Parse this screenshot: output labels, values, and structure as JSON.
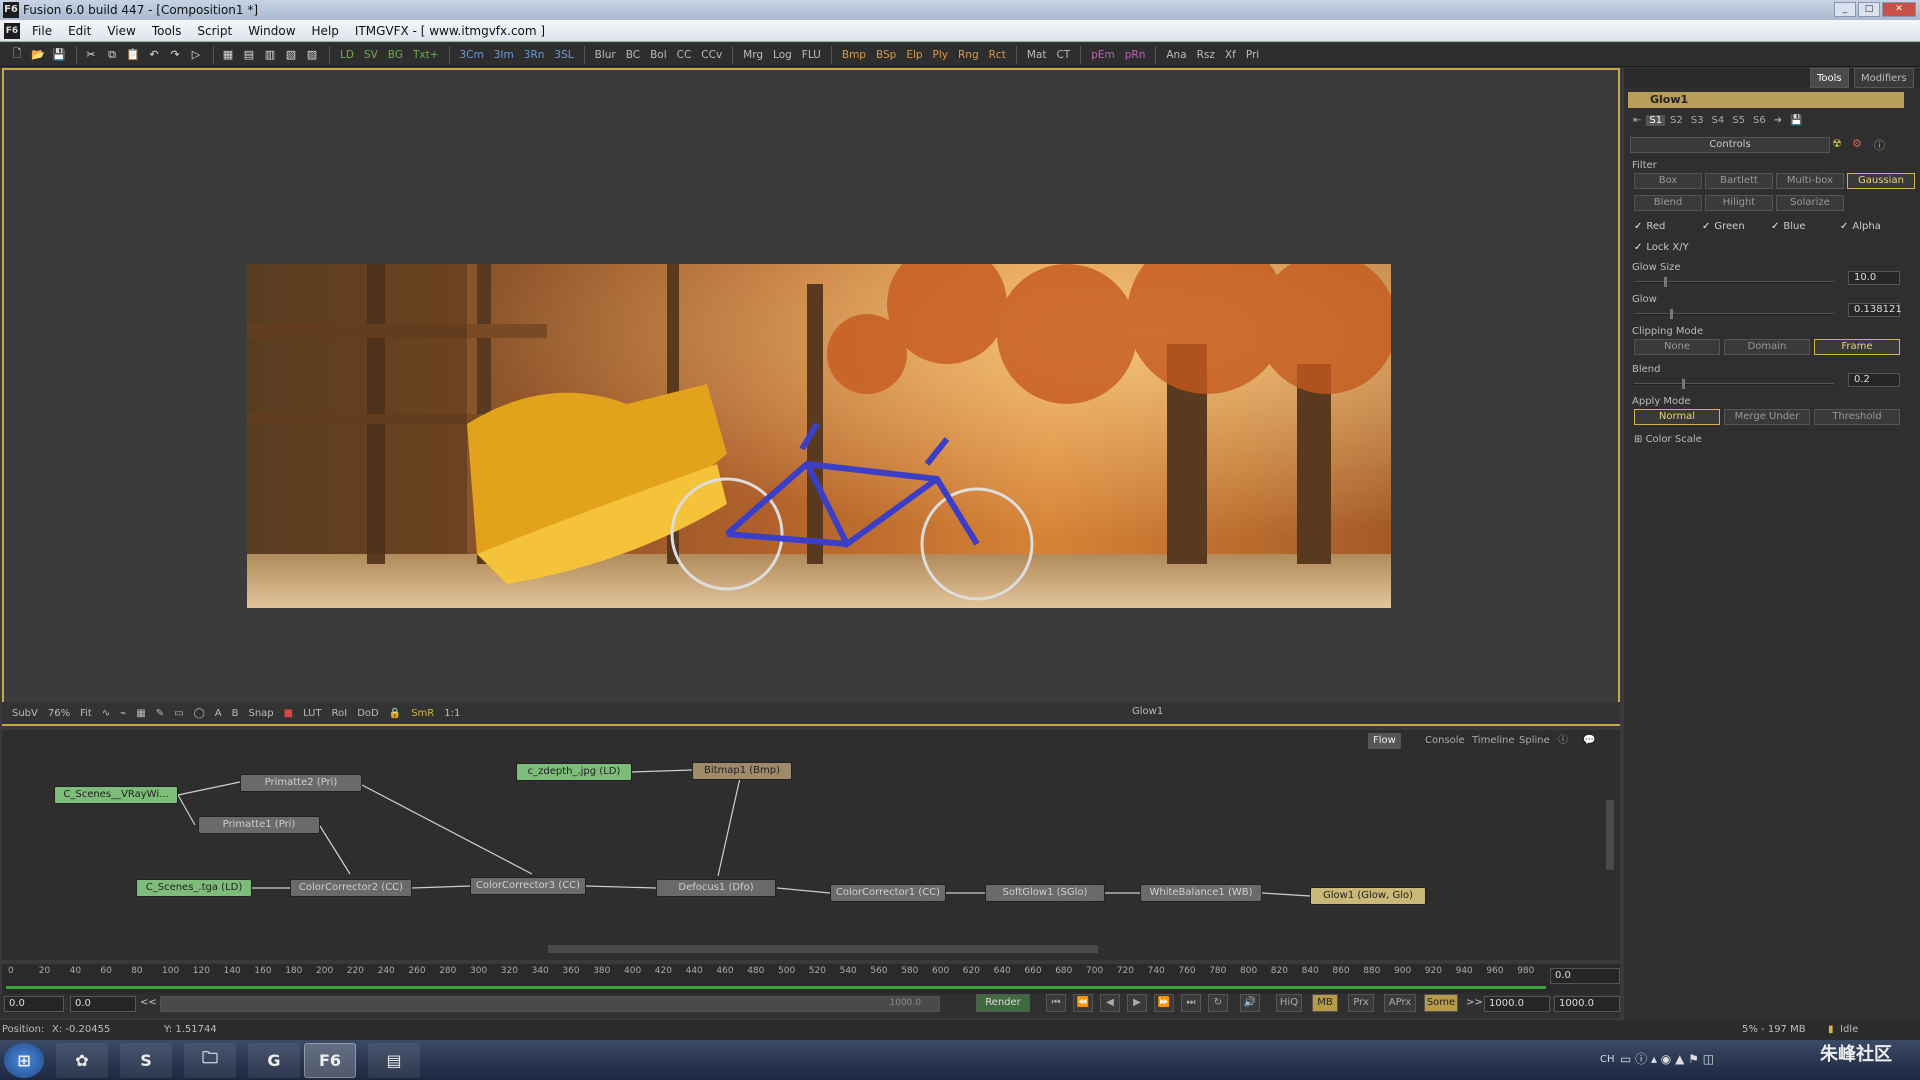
{
  "window": {
    "title": "Fusion 6.0 build 447 - [Composition1 *]",
    "app_icon": "F6"
  },
  "menu": {
    "items": [
      "File",
      "Edit",
      "View",
      "Tools",
      "Script",
      "Window",
      "Help",
      "ITMGVFX - [ www.itmgvfx.com ]"
    ]
  },
  "toolbar": {
    "tools": [
      {
        "label": "LD",
        "color": "g"
      },
      {
        "label": "SV",
        "color": "g"
      },
      {
        "label": "BG",
        "color": "g"
      },
      {
        "label": "Txt+",
        "color": "g"
      },
      {
        "label": "3Cm",
        "color": "b"
      },
      {
        "label": "3Im",
        "color": "b"
      },
      {
        "label": "3Rn",
        "color": "b"
      },
      {
        "label": "3SL",
        "color": "b"
      },
      {
        "label": "Blur",
        "color": ""
      },
      {
        "label": "BC",
        "color": ""
      },
      {
        "label": "Bol",
        "color": ""
      },
      {
        "label": "CC",
        "color": ""
      },
      {
        "label": "CCv",
        "color": ""
      },
      {
        "label": "Mrg",
        "color": ""
      },
      {
        "label": "Log",
        "color": ""
      },
      {
        "label": "FLU",
        "color": ""
      },
      {
        "label": "Bmp",
        "color": "o"
      },
      {
        "label": "BSp",
        "color": "o"
      },
      {
        "label": "Elp",
        "color": "o"
      },
      {
        "label": "Ply",
        "color": "o"
      },
      {
        "label": "Rng",
        "color": "o"
      },
      {
        "label": "Rct",
        "color": "o"
      },
      {
        "label": "Mat",
        "color": ""
      },
      {
        "label": "CT",
        "color": ""
      },
      {
        "label": "pEm",
        "color": "p"
      },
      {
        "label": "pRn",
        "color": "p"
      },
      {
        "label": "Ana",
        "color": ""
      },
      {
        "label": "Rsz",
        "color": ""
      },
      {
        "label": "Xf",
        "color": ""
      },
      {
        "label": "Pri",
        "color": ""
      }
    ]
  },
  "viewer": {
    "resolution": "1500x450",
    "image_alt": "Autumn playground with yellow slide and a blue bicycle",
    "bar": {
      "subview": "SubV",
      "zoom": "76%",
      "fit": "Fit",
      "snap": "Snap",
      "lut": "LUT",
      "roi": "RoI",
      "dod": "DoD",
      "smr": "SmR",
      "onetoone": "1:1",
      "tool": "Glow1"
    }
  },
  "panel": {
    "tabs": [
      "Tools",
      "Modifiers"
    ],
    "tool_name": "Glow1",
    "subtabs": [
      "S1",
      "S2",
      "S3",
      "S4",
      "S5",
      "S6"
    ],
    "controls_label": "Controls",
    "filter_label": "Filter",
    "filter_buttons": [
      "Box",
      "Bartlett",
      "Multi-box",
      "Gaussian",
      "Blend",
      "Hilight",
      "Solarize"
    ],
    "filter_selected": "Gaussian",
    "channels": [
      "Red",
      "Green",
      "Blue",
      "Alpha"
    ],
    "lock_xy": "Lock X/Y",
    "glow_size_label": "Glow Size",
    "glow_size": "10.0",
    "glow_label": "Glow",
    "glow": "0.138121",
    "clipping_label": "Clipping Mode",
    "clipping_buttons": [
      "None",
      "Domain",
      "Frame"
    ],
    "clipping_selected": "Frame",
    "blend_label": "Blend",
    "blend": "0.2",
    "apply_label": "Apply Mode",
    "apply_buttons": [
      "Normal",
      "Merge Under",
      "Threshold"
    ],
    "apply_selected": "Normal",
    "color_scale": "Color Scale"
  },
  "flow": {
    "tabs": [
      "Flow",
      "Console",
      "Timeline",
      "Spline"
    ],
    "nodes": [
      {
        "id": "n1",
        "label": "C_Scenes__VRayWi..."
      },
      {
        "id": "n2",
        "label": "Primatte2  (Pri)"
      },
      {
        "id": "n3",
        "label": "Primatte1  (Pri)"
      },
      {
        "id": "n4",
        "label": "c_zdepth_.jpg  (LD)"
      },
      {
        "id": "n5",
        "label": "Bitmap1  (Bmp)"
      },
      {
        "id": "n6",
        "label": "C_Scenes_.tga  (LD)"
      },
      {
        "id": "n7",
        "label": "ColorCorrector2  (CC)"
      },
      {
        "id": "n8",
        "label": "ColorCorrector3  (CC)"
      },
      {
        "id": "n9",
        "label": "Defocus1  (Dfo)"
      },
      {
        "id": "n10",
        "label": "ColorCorrector1  (CC)"
      },
      {
        "id": "n11",
        "label": "SoftGlow1  (SGlo)"
      },
      {
        "id": "n12",
        "label": "WhiteBalance1  (WB)"
      },
      {
        "id": "n13",
        "label": "Glow1  (Glow, Glo)"
      }
    ]
  },
  "timeline": {
    "ticks": [
      "0",
      "20",
      "40",
      "60",
      "80",
      "100",
      "120",
      "140",
      "160",
      "180",
      "200",
      "220",
      "240",
      "260",
      "280",
      "300",
      "320",
      "340",
      "360",
      "380",
      "400",
      "420",
      "440",
      "460",
      "480",
      "500",
      "520",
      "540",
      "560",
      "580",
      "600",
      "620",
      "640",
      "660",
      "680",
      "700",
      "720",
      "740",
      "760",
      "780",
      "800",
      "820",
      "840",
      "860",
      "880",
      "900",
      "920",
      "940",
      "960",
      "980"
    ],
    "current": "0.0",
    "start": "0.0",
    "render_start": "0.0",
    "nav": "<<",
    "range_end_mark": "1000.0",
    "render_label": "Render",
    "hiq": "HiQ",
    "mb": "MB",
    "prx": "Prx",
    "aprx": "APrx",
    "some": "Some",
    "nav_fwd": ">>",
    "render_end": "1000.0",
    "end": "1000.0"
  },
  "status": {
    "position_label": "Position:",
    "x": "X:  -0.20455",
    "y": "Y:  1.51744",
    "memory": "5% - 197 MB",
    "state": "Idle"
  },
  "taskbar": {
    "clock_line": "CH",
    "watermark": "朱峰社区"
  }
}
